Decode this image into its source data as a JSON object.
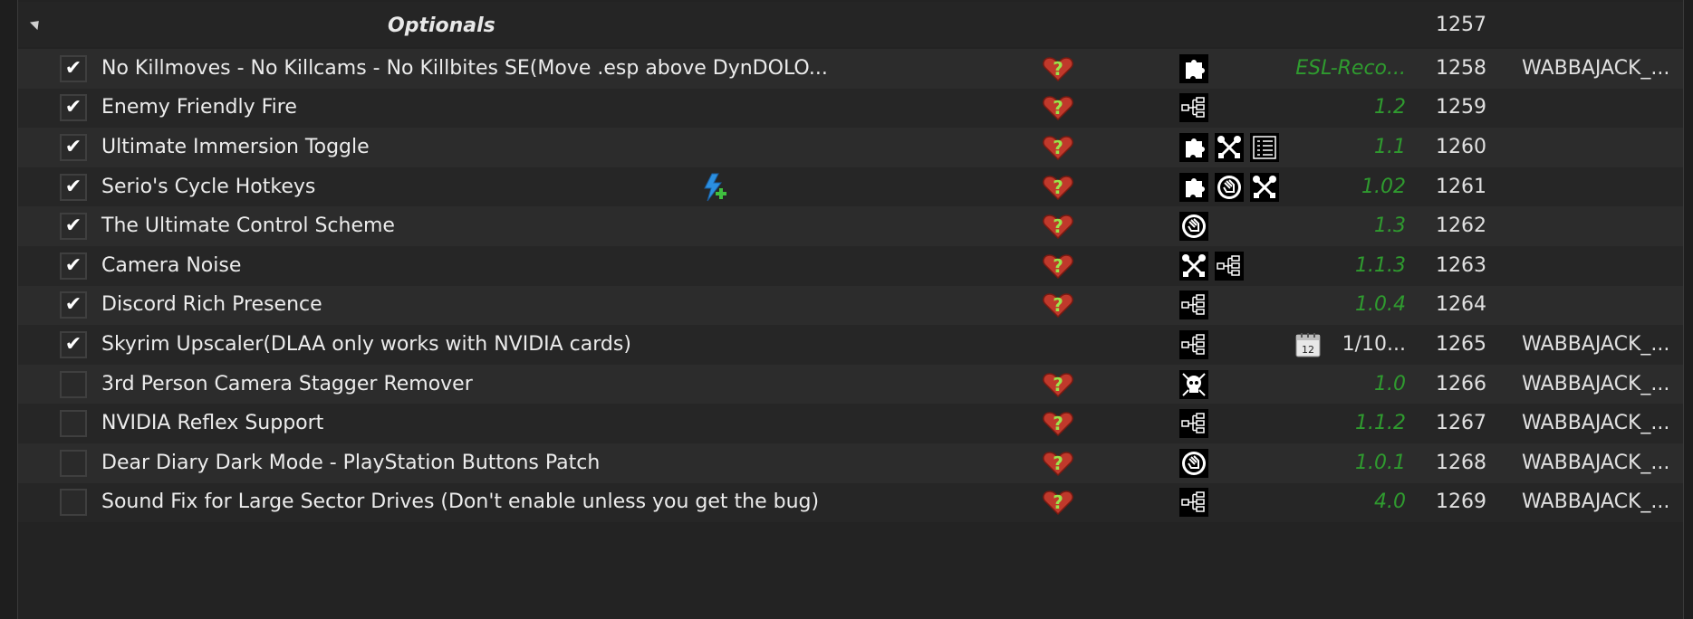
{
  "separator": {
    "title": "Optionals",
    "priority": "1257"
  },
  "rows": [
    {
      "name": "No Killmoves - No Killcams - No Killbites SE(Move .esp above DynDOLO...",
      "checked": true,
      "flag": true,
      "features": [
        "puzzle-icon"
      ],
      "version": "ESL-Reco...",
      "priority": "1258",
      "source": "WABBAJACK_..."
    },
    {
      "name": "Enemy Friendly Fire",
      "checked": true,
      "flag": true,
      "features": [
        "plugin-tree-icon"
      ],
      "version": "1.2",
      "priority": "1259",
      "source": ""
    },
    {
      "name": "Ultimate Immersion Toggle",
      "checked": true,
      "flag": true,
      "features": [
        "puzzle-icon",
        "tools-icon",
        "config-list-icon"
      ],
      "version": "1.1",
      "priority": "1260",
      "source": ""
    },
    {
      "name": "Serio's Cycle Hotkeys",
      "checked": true,
      "flag": true,
      "features": [
        "puzzle-icon",
        "script-hand-icon",
        "tools-icon"
      ],
      "version": "1.02",
      "priority": "1261",
      "source": "",
      "bolt": true
    },
    {
      "name": "The Ultimate Control Scheme",
      "checked": true,
      "flag": true,
      "features": [
        "script-hand-icon"
      ],
      "version": "1.3",
      "priority": "1262",
      "source": ""
    },
    {
      "name": "Camera Noise",
      "checked": true,
      "flag": true,
      "features": [
        "tools-icon",
        "plugin-tree-icon"
      ],
      "version": "1.1.3",
      "priority": "1263",
      "source": ""
    },
    {
      "name": "Discord Rich Presence",
      "checked": true,
      "flag": true,
      "features": [
        "plugin-tree-icon"
      ],
      "version": "1.0.4",
      "priority": "1264",
      "source": ""
    },
    {
      "name": "Skyrim Upscaler(DLAA only works with NVIDIA cards)",
      "checked": true,
      "flag": false,
      "features": [
        "plugin-tree-icon"
      ],
      "version": "1/10...",
      "priority": "1265",
      "source": "WABBAJACK_...",
      "calendar": true
    },
    {
      "name": "3rd Person Camera Stagger Remover",
      "checked": false,
      "flag": true,
      "features": [
        "skull-icon"
      ],
      "version": "1.0",
      "priority": "1266",
      "source": "WABBAJACK_..."
    },
    {
      "name": "NVIDIA Reflex Support",
      "checked": false,
      "flag": true,
      "features": [
        "plugin-tree-icon"
      ],
      "version": "1.1.2",
      "priority": "1267",
      "source": "WABBAJACK_..."
    },
    {
      "name": "Dear Diary Dark Mode - PlayStation Buttons Patch",
      "checked": false,
      "flag": true,
      "features": [
        "script-hand-icon"
      ],
      "version": "1.0.1",
      "priority": "1268",
      "source": "WABBAJACK_..."
    },
    {
      "name": "Sound Fix for Large Sector Drives (Don't enable unless you get the bug)",
      "checked": false,
      "flag": true,
      "features": [
        "plugin-tree-icon"
      ],
      "version": "4.0",
      "priority": "1269",
      "source": "WABBAJACK_..."
    }
  ],
  "check_glyph": "✔"
}
